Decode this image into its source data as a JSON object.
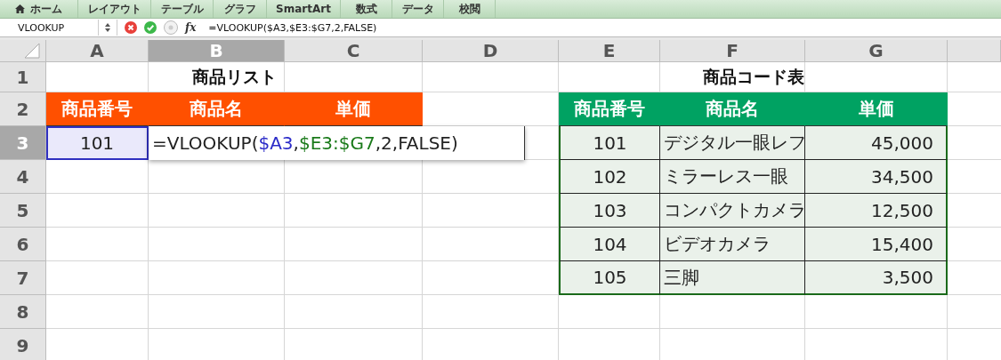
{
  "ribbon_tabs": [
    {
      "label": "ホーム",
      "kind": "home"
    },
    {
      "label": "レイアウト",
      "kind": "plain"
    },
    {
      "label": "テーブル",
      "kind": "plain"
    },
    {
      "label": "グラフ",
      "kind": "plain"
    },
    {
      "label": "SmartArt",
      "kind": "plain"
    },
    {
      "label": "数式",
      "kind": "plain"
    },
    {
      "label": "データ",
      "kind": "plain"
    },
    {
      "label": "校閲",
      "kind": "plain"
    }
  ],
  "formula_bar": {
    "name_box": "VLOOKUP",
    "fx": "fx",
    "formula": "=VLOOKUP($A3,$E3:$G7,2,FALSE)"
  },
  "columns": [
    {
      "label": "A",
      "selected": false
    },
    {
      "label": "B",
      "selected": true
    },
    {
      "label": "C",
      "selected": false
    },
    {
      "label": "D",
      "selected": false
    },
    {
      "label": "E",
      "selected": false
    },
    {
      "label": "F",
      "selected": false
    },
    {
      "label": "G",
      "selected": false
    }
  ],
  "rows": [
    {
      "label": "1",
      "selected": false
    },
    {
      "label": "2",
      "selected": false
    },
    {
      "label": "3",
      "selected": true
    },
    {
      "label": "4",
      "selected": false
    },
    {
      "label": "5",
      "selected": false
    },
    {
      "label": "6",
      "selected": false
    },
    {
      "label": "7",
      "selected": false
    },
    {
      "label": "8",
      "selected": false
    },
    {
      "label": "9",
      "selected": false
    }
  ],
  "product_list": {
    "title": "商品リスト",
    "headers": [
      "商品番号",
      "商品名",
      "単価"
    ],
    "lookup_value": "101",
    "editor": [
      {
        "text": "=VLOOKUP(",
        "color": "#222222"
      },
      {
        "text": "$A3",
        "color": "#2a2ac8"
      },
      {
        "text": ",",
        "color": "#222222"
      },
      {
        "text": "$E3:$G7",
        "color": "#1a7a1a"
      },
      {
        "text": ",2,FALSE)",
        "color": "#222222"
      }
    ]
  },
  "code_table": {
    "title": "商品コード表",
    "headers": [
      "商品番号",
      "商品名",
      "単価"
    ],
    "rows": [
      {
        "id": "101",
        "name": "デジタル一眼レフ",
        "price": "45,000"
      },
      {
        "id": "102",
        "name": "ミラーレス一眼",
        "price": "34,500"
      },
      {
        "id": "103",
        "name": "コンパクトカメラ",
        "price": "12,500"
      },
      {
        "id": "104",
        "name": "ビデオカメラ",
        "price": "15,400"
      },
      {
        "id": "105",
        "name": "三脚",
        "price": "3,500"
      }
    ]
  }
}
